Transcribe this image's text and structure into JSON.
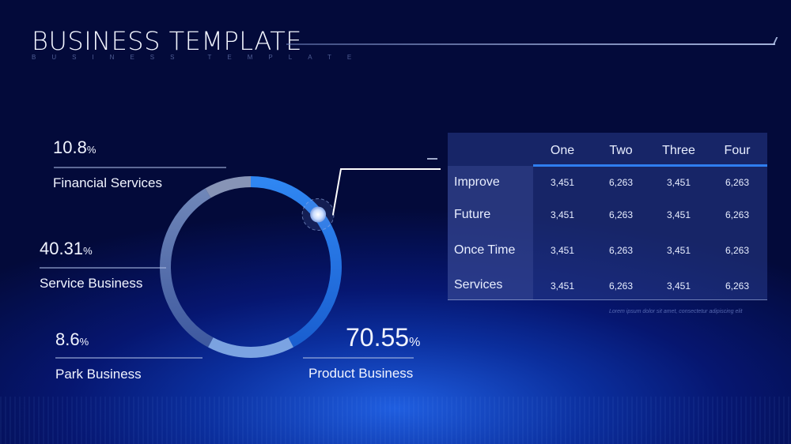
{
  "header": {
    "title": "BUSINESS TEMPLATE",
    "subtitle": "BUSINESS TEMPLATE"
  },
  "colors": {
    "accent": "#2f7ef0",
    "ring_blue": "#2a7de8",
    "background": "#061670"
  },
  "chart_data": {
    "type": "pie",
    "style": "ring",
    "title": "",
    "categories": [
      "Product Business",
      "Park Business",
      "Service Business",
      "Financial Services"
    ],
    "values": [
      70.55,
      8.6,
      40.31,
      10.8
    ],
    "unit": "%",
    "labels": [
      {
        "category": "Financial Services",
        "value_text": "10.8",
        "unit": "%"
      },
      {
        "category": "Service Business",
        "value_text": "40.31",
        "unit": "%"
      },
      {
        "category": "Park Business",
        "value_text": "8.6",
        "unit": "%"
      },
      {
        "category": "Product Business",
        "value_text": "70.55",
        "unit": "%"
      }
    ]
  },
  "table": {
    "columns": [
      "One",
      "Two",
      "Three",
      "Four"
    ],
    "rows": [
      {
        "label": "Improve",
        "values": [
          "3,451",
          "6,263",
          "3,451",
          "6,263"
        ]
      },
      {
        "label": "Future",
        "values": [
          "3,451",
          "6,263",
          "3,451",
          "6,263"
        ]
      },
      {
        "label": "Once Time",
        "values": [
          "3,451",
          "6,263",
          "3,451",
          "6,263"
        ]
      },
      {
        "label": "Services",
        "values": [
          "3,451",
          "6,263",
          "3,451",
          "6,263"
        ]
      }
    ],
    "note": "Lorem ipsum dolor sit amet, consectetur adipiscing elit"
  }
}
